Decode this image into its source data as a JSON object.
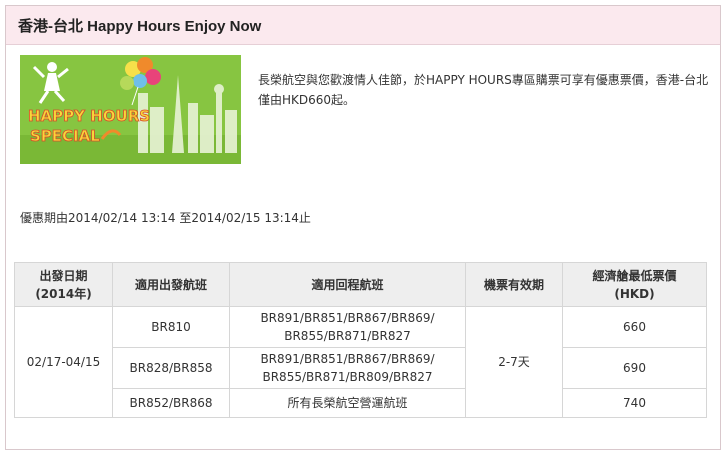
{
  "header": {
    "title": "香港-台北 Happy Hours Enjoy Now"
  },
  "banner": {
    "logo_text_line1": "HAPPY HOURS",
    "logo_text_line2": "SPECIAL"
  },
  "intro": {
    "text": "長榮航空與您歡渡情人佳節，於HAPPY HOURS專區購票可享有優惠票價，香港-台北僅由HKD660起。"
  },
  "period": {
    "text": "優惠期由2014/02/14 13:14 至2014/02/15 13:14止"
  },
  "table": {
    "headers": {
      "date": "出發日期\n(2014年)",
      "outbound": "適用出發航班",
      "return": "適用回程航班",
      "validity": "機票有效期",
      "fare": "經濟艙最低票價\n(HKD)"
    },
    "date_range": "02/17-04/15",
    "validity": "2-7天",
    "rows": [
      {
        "outbound": "BR810",
        "return": "BR891/BR851/BR867/BR869/\nBR855/BR871/BR827",
        "fare": "660"
      },
      {
        "outbound": "BR828/BR858",
        "return": "BR891/BR851/BR867/BR869/\nBR855/BR871/BR809/BR827",
        "fare": "690"
      },
      {
        "outbound": "BR852/BR868",
        "return": "所有長榮航空營運航班",
        "fare": "740"
      }
    ]
  },
  "colors": {
    "header_bg": "#fbe9ee",
    "banner_green": "#87c541",
    "table_header_bg": "#eeeeee"
  }
}
